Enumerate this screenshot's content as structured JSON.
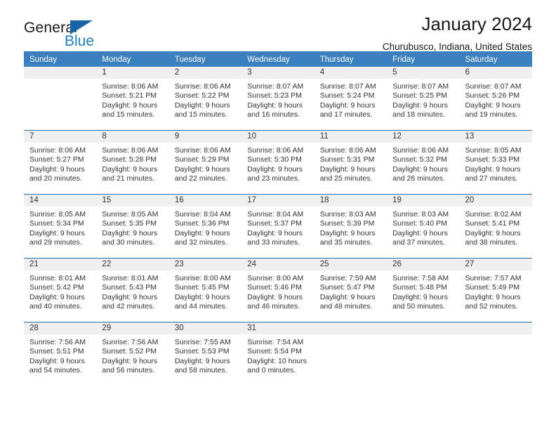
{
  "brand": {
    "name_part1": "General",
    "name_part2": "Blue",
    "triangle_icon": "triangle-icon"
  },
  "header": {
    "title": "January 2024",
    "location": "Churubusco, Indiana, United States"
  },
  "colors": {
    "header_blue": "#3a7fbe",
    "row_divider_blue": "#2f6fa8",
    "day_band_gray": "#efefef",
    "brand_blue": "#1f7fc4"
  },
  "weekdays": [
    "Sunday",
    "Monday",
    "Tuesday",
    "Wednesday",
    "Thursday",
    "Friday",
    "Saturday"
  ],
  "weeks": [
    [
      {
        "day": "",
        "sunrise": "",
        "sunset": "",
        "daylight_line1": "",
        "daylight_line2": ""
      },
      {
        "day": "1",
        "sunrise": "Sunrise: 8:06 AM",
        "sunset": "Sunset: 5:21 PM",
        "daylight_line1": "Daylight: 9 hours",
        "daylight_line2": "and 15 minutes."
      },
      {
        "day": "2",
        "sunrise": "Sunrise: 8:06 AM",
        "sunset": "Sunset: 5:22 PM",
        "daylight_line1": "Daylight: 9 hours",
        "daylight_line2": "and 15 minutes."
      },
      {
        "day": "3",
        "sunrise": "Sunrise: 8:07 AM",
        "sunset": "Sunset: 5:23 PM",
        "daylight_line1": "Daylight: 9 hours",
        "daylight_line2": "and 16 minutes."
      },
      {
        "day": "4",
        "sunrise": "Sunrise: 8:07 AM",
        "sunset": "Sunset: 5:24 PM",
        "daylight_line1": "Daylight: 9 hours",
        "daylight_line2": "and 17 minutes."
      },
      {
        "day": "5",
        "sunrise": "Sunrise: 8:07 AM",
        "sunset": "Sunset: 5:25 PM",
        "daylight_line1": "Daylight: 9 hours",
        "daylight_line2": "and 18 minutes."
      },
      {
        "day": "6",
        "sunrise": "Sunrise: 8:07 AM",
        "sunset": "Sunset: 5:26 PM",
        "daylight_line1": "Daylight: 9 hours",
        "daylight_line2": "and 19 minutes."
      }
    ],
    [
      {
        "day": "7",
        "sunrise": "Sunrise: 8:06 AM",
        "sunset": "Sunset: 5:27 PM",
        "daylight_line1": "Daylight: 9 hours",
        "daylight_line2": "and 20 minutes."
      },
      {
        "day": "8",
        "sunrise": "Sunrise: 8:06 AM",
        "sunset": "Sunset: 5:28 PM",
        "daylight_line1": "Daylight: 9 hours",
        "daylight_line2": "and 21 minutes."
      },
      {
        "day": "9",
        "sunrise": "Sunrise: 8:06 AM",
        "sunset": "Sunset: 5:29 PM",
        "daylight_line1": "Daylight: 9 hours",
        "daylight_line2": "and 22 minutes."
      },
      {
        "day": "10",
        "sunrise": "Sunrise: 8:06 AM",
        "sunset": "Sunset: 5:30 PM",
        "daylight_line1": "Daylight: 9 hours",
        "daylight_line2": "and 23 minutes."
      },
      {
        "day": "11",
        "sunrise": "Sunrise: 8:06 AM",
        "sunset": "Sunset: 5:31 PM",
        "daylight_line1": "Daylight: 9 hours",
        "daylight_line2": "and 25 minutes."
      },
      {
        "day": "12",
        "sunrise": "Sunrise: 8:06 AM",
        "sunset": "Sunset: 5:32 PM",
        "daylight_line1": "Daylight: 9 hours",
        "daylight_line2": "and 26 minutes."
      },
      {
        "day": "13",
        "sunrise": "Sunrise: 8:05 AM",
        "sunset": "Sunset: 5:33 PM",
        "daylight_line1": "Daylight: 9 hours",
        "daylight_line2": "and 27 minutes."
      }
    ],
    [
      {
        "day": "14",
        "sunrise": "Sunrise: 8:05 AM",
        "sunset": "Sunset: 5:34 PM",
        "daylight_line1": "Daylight: 9 hours",
        "daylight_line2": "and 29 minutes."
      },
      {
        "day": "15",
        "sunrise": "Sunrise: 8:05 AM",
        "sunset": "Sunset: 5:35 PM",
        "daylight_line1": "Daylight: 9 hours",
        "daylight_line2": "and 30 minutes."
      },
      {
        "day": "16",
        "sunrise": "Sunrise: 8:04 AM",
        "sunset": "Sunset: 5:36 PM",
        "daylight_line1": "Daylight: 9 hours",
        "daylight_line2": "and 32 minutes."
      },
      {
        "day": "17",
        "sunrise": "Sunrise: 8:04 AM",
        "sunset": "Sunset: 5:37 PM",
        "daylight_line1": "Daylight: 9 hours",
        "daylight_line2": "and 33 minutes."
      },
      {
        "day": "18",
        "sunrise": "Sunrise: 8:03 AM",
        "sunset": "Sunset: 5:39 PM",
        "daylight_line1": "Daylight: 9 hours",
        "daylight_line2": "and 35 minutes."
      },
      {
        "day": "19",
        "sunrise": "Sunrise: 8:03 AM",
        "sunset": "Sunset: 5:40 PM",
        "daylight_line1": "Daylight: 9 hours",
        "daylight_line2": "and 37 minutes."
      },
      {
        "day": "20",
        "sunrise": "Sunrise: 8:02 AM",
        "sunset": "Sunset: 5:41 PM",
        "daylight_line1": "Daylight: 9 hours",
        "daylight_line2": "and 38 minutes."
      }
    ],
    [
      {
        "day": "21",
        "sunrise": "Sunrise: 8:01 AM",
        "sunset": "Sunset: 5:42 PM",
        "daylight_line1": "Daylight: 9 hours",
        "daylight_line2": "and 40 minutes."
      },
      {
        "day": "22",
        "sunrise": "Sunrise: 8:01 AM",
        "sunset": "Sunset: 5:43 PM",
        "daylight_line1": "Daylight: 9 hours",
        "daylight_line2": "and 42 minutes."
      },
      {
        "day": "23",
        "sunrise": "Sunrise: 8:00 AM",
        "sunset": "Sunset: 5:45 PM",
        "daylight_line1": "Daylight: 9 hours",
        "daylight_line2": "and 44 minutes."
      },
      {
        "day": "24",
        "sunrise": "Sunrise: 8:00 AM",
        "sunset": "Sunset: 5:46 PM",
        "daylight_line1": "Daylight: 9 hours",
        "daylight_line2": "and 46 minutes."
      },
      {
        "day": "25",
        "sunrise": "Sunrise: 7:59 AM",
        "sunset": "Sunset: 5:47 PM",
        "daylight_line1": "Daylight: 9 hours",
        "daylight_line2": "and 48 minutes."
      },
      {
        "day": "26",
        "sunrise": "Sunrise: 7:58 AM",
        "sunset": "Sunset: 5:48 PM",
        "daylight_line1": "Daylight: 9 hours",
        "daylight_line2": "and 50 minutes."
      },
      {
        "day": "27",
        "sunrise": "Sunrise: 7:57 AM",
        "sunset": "Sunset: 5:49 PM",
        "daylight_line1": "Daylight: 9 hours",
        "daylight_line2": "and 52 minutes."
      }
    ],
    [
      {
        "day": "28",
        "sunrise": "Sunrise: 7:56 AM",
        "sunset": "Sunset: 5:51 PM",
        "daylight_line1": "Daylight: 9 hours",
        "daylight_line2": "and 54 minutes."
      },
      {
        "day": "29",
        "sunrise": "Sunrise: 7:56 AM",
        "sunset": "Sunset: 5:52 PM",
        "daylight_line1": "Daylight: 9 hours",
        "daylight_line2": "and 56 minutes."
      },
      {
        "day": "30",
        "sunrise": "Sunrise: 7:55 AM",
        "sunset": "Sunset: 5:53 PM",
        "daylight_line1": "Daylight: 9 hours",
        "daylight_line2": "and 58 minutes."
      },
      {
        "day": "31",
        "sunrise": "Sunrise: 7:54 AM",
        "sunset": "Sunset: 5:54 PM",
        "daylight_line1": "Daylight: 10 hours",
        "daylight_line2": "and 0 minutes."
      },
      {
        "day": "",
        "sunrise": "",
        "sunset": "",
        "daylight_line1": "",
        "daylight_line2": ""
      },
      {
        "day": "",
        "sunrise": "",
        "sunset": "",
        "daylight_line1": "",
        "daylight_line2": ""
      },
      {
        "day": "",
        "sunrise": "",
        "sunset": "",
        "daylight_line1": "",
        "daylight_line2": ""
      }
    ]
  ]
}
